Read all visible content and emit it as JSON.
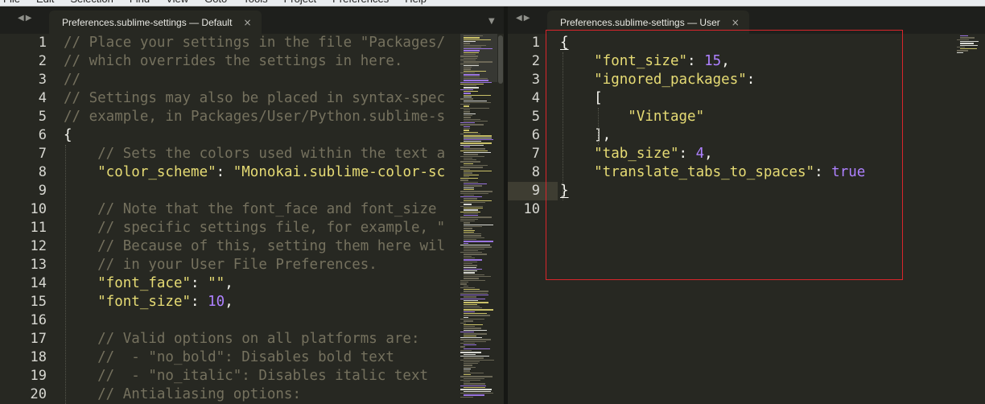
{
  "menu": [
    "File",
    "Edit",
    "Selection",
    "Find",
    "View",
    "Goto",
    "Tools",
    "Project",
    "Preferences",
    "Help"
  ],
  "tabs": {
    "left": {
      "title": "Preferences.sublime-settings — Default",
      "close": "×"
    },
    "right": {
      "title": "Preferences.sublime-settings — User",
      "close": "×"
    }
  },
  "icons": {
    "nav_prev": "◀",
    "nav_next": "▶",
    "dropdown": "▼"
  },
  "colors": {
    "background": "#272822",
    "comment": "#75715e",
    "string": "#e6db74",
    "number": "#ae81ff",
    "highlight_box": "#d9252b"
  },
  "left_editor": {
    "line_numbers": [
      "1",
      "2",
      "3",
      "4",
      "5",
      "6",
      "7",
      "8",
      "9",
      "10",
      "11",
      "12",
      "13",
      "14",
      "15",
      "16",
      "17",
      "18",
      "19",
      "20"
    ],
    "lines": [
      [
        {
          "t": "// Place your settings in the file \"Packages/",
          "c": "cm"
        }
      ],
      [
        {
          "t": "// which overrides the settings in here.",
          "c": "cm"
        }
      ],
      [
        {
          "t": "//",
          "c": "cm"
        }
      ],
      [
        {
          "t": "// Settings may also be placed in syntax-spec",
          "c": "cm"
        }
      ],
      [
        {
          "t": "// example, in Packages/User/Python.sublime-s",
          "c": "cm"
        }
      ],
      [
        {
          "t": "{",
          "c": "pu"
        }
      ],
      [
        {
          "t": "    // Sets the colors used within the text a",
          "c": "cm"
        }
      ],
      [
        {
          "t": "    \"color_scheme\"",
          "c": "st"
        },
        {
          "t": ": ",
          "c": "pu"
        },
        {
          "t": "\"Monokai.sublime-color-sc",
          "c": "st"
        }
      ],
      [
        {
          "t": "",
          "c": "pu"
        }
      ],
      [
        {
          "t": "    // Note that the font_face and font_size",
          "c": "cm"
        }
      ],
      [
        {
          "t": "    // specific settings file, for example, \"",
          "c": "cm"
        }
      ],
      [
        {
          "t": "    // Because of this, setting them here wil",
          "c": "cm"
        }
      ],
      [
        {
          "t": "    // in your User File Preferences.",
          "c": "cm"
        }
      ],
      [
        {
          "t": "    \"font_face\"",
          "c": "st"
        },
        {
          "t": ": ",
          "c": "pu"
        },
        {
          "t": "\"\"",
          "c": "st"
        },
        {
          "t": ",",
          "c": "pu"
        }
      ],
      [
        {
          "t": "    \"font_size\"",
          "c": "st"
        },
        {
          "t": ": ",
          "c": "pu"
        },
        {
          "t": "10",
          "c": "nu"
        },
        {
          "t": ",",
          "c": "pu"
        }
      ],
      [
        {
          "t": "",
          "c": "pu"
        }
      ],
      [
        {
          "t": "    // Valid options on all platforms are:",
          "c": "cm"
        }
      ],
      [
        {
          "t": "    //  - \"no_bold\": Disables bold text",
          "c": "cm"
        }
      ],
      [
        {
          "t": "    //  - \"no_italic\": Disables italic text",
          "c": "cm"
        }
      ],
      [
        {
          "t": "    // Antialiasing options:",
          "c": "cm"
        }
      ]
    ]
  },
  "right_editor": {
    "line_numbers": [
      "1",
      "2",
      "3",
      "4",
      "5",
      "6",
      "7",
      "8",
      "9",
      "10"
    ],
    "current_line": 9,
    "lines": [
      [
        {
          "t": "{",
          "c": "brm"
        }
      ],
      [
        {
          "t": "    \"font_size\"",
          "c": "st"
        },
        {
          "t": ": ",
          "c": "pu"
        },
        {
          "t": "15",
          "c": "nu"
        },
        {
          "t": ",",
          "c": "pu"
        }
      ],
      [
        {
          "t": "    \"ignored_packages\"",
          "c": "st"
        },
        {
          "t": ":",
          "c": "pu"
        }
      ],
      [
        {
          "t": "    [",
          "c": "pu"
        }
      ],
      [
        {
          "t": "        \"Vintage\"",
          "c": "st"
        }
      ],
      [
        {
          "t": "    ],",
          "c": "pu"
        }
      ],
      [
        {
          "t": "    \"tab_size\"",
          "c": "st"
        },
        {
          "t": ": ",
          "c": "pu"
        },
        {
          "t": "4",
          "c": "nu"
        },
        {
          "t": ",",
          "c": "pu"
        }
      ],
      [
        {
          "t": "    \"translate_tabs_to_spaces\"",
          "c": "st"
        },
        {
          "t": ": ",
          "c": "pu"
        },
        {
          "t": "true",
          "c": "ct"
        }
      ],
      [
        {
          "t": "}",
          "c": "brm"
        }
      ],
      [
        {
          "t": "",
          "c": "pu"
        }
      ]
    ]
  }
}
